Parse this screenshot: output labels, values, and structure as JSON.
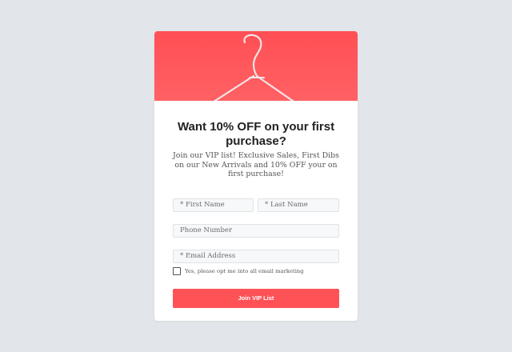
{
  "colors": {
    "page_background": "#e2e6ea",
    "hero_red": "#ff5559",
    "button_red": "#ff5257",
    "card_background": "#ffffff"
  },
  "hero": {
    "image": "coat-hanger-icon"
  },
  "popup": {
    "title": "Want 10% OFF on your first purchase?",
    "subtitle": "Join our VIP list! Exclusive Sales, First Dibs on our New Arrivals and 10% OFF your on first purchase!"
  },
  "form": {
    "first_name_placeholder": "* First Name",
    "last_name_placeholder": "* Last Name",
    "phone_placeholder": "Phone Number",
    "email_placeholder": "* Email Address",
    "optin_label": "Yes, please opt me into all email marketing",
    "optin_checked": false,
    "submit_label": "Join VIP List"
  }
}
